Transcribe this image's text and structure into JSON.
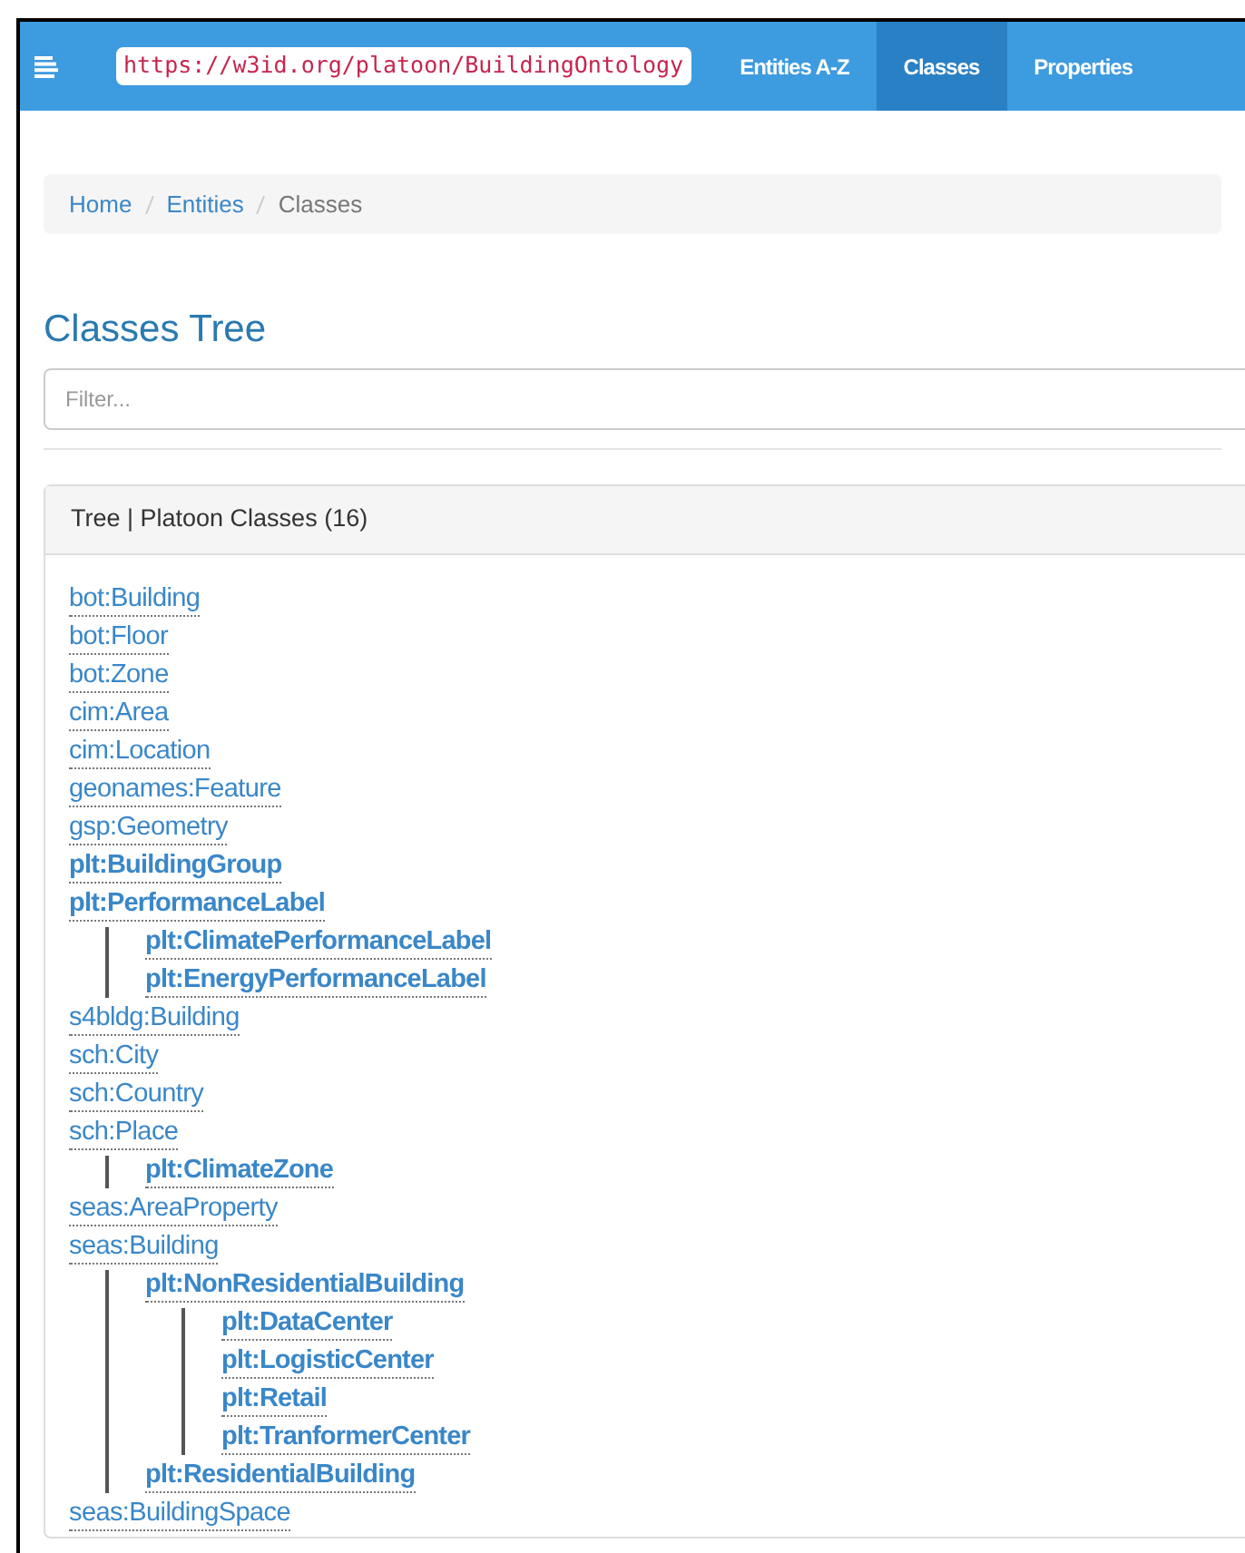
{
  "navbar": {
    "url": "https://w3id.org/platoon/BuildingOntology",
    "links": [
      {
        "label": "Entities A-Z",
        "selected": false
      },
      {
        "label": "Classes",
        "selected": true
      },
      {
        "label": "Properties",
        "selected": false
      }
    ]
  },
  "breadcrumb": [
    {
      "label": "Home",
      "link": true
    },
    {
      "label": "Entities",
      "link": true
    },
    {
      "label": "Classes",
      "link": false
    }
  ],
  "heading": "Classes Tree",
  "filter": {
    "placeholder": "Filter..."
  },
  "panel": {
    "title": "Tree | Platoon Classes (16)"
  },
  "tree": [
    {
      "label": "bot:Building",
      "bold": false
    },
    {
      "label": "bot:Floor",
      "bold": false
    },
    {
      "label": "bot:Zone",
      "bold": false
    },
    {
      "label": "cim:Area",
      "bold": false
    },
    {
      "label": "cim:Location",
      "bold": false
    },
    {
      "label": "geonames:Feature",
      "bold": false
    },
    {
      "label": "gsp:Geometry",
      "bold": false
    },
    {
      "label": "plt:BuildingGroup",
      "bold": true
    },
    {
      "label": "plt:PerformanceLabel",
      "bold": true,
      "children": [
        {
          "label": "plt:ClimatePerformanceLabel",
          "bold": true
        },
        {
          "label": "plt:EnergyPerformanceLabel",
          "bold": true
        }
      ]
    },
    {
      "label": "s4bldg:Building",
      "bold": false
    },
    {
      "label": "sch:City",
      "bold": false
    },
    {
      "label": "sch:Country",
      "bold": false
    },
    {
      "label": "sch:Place",
      "bold": false,
      "children": [
        {
          "label": "plt:ClimateZone",
          "bold": true
        }
      ]
    },
    {
      "label": "seas:AreaProperty",
      "bold": false
    },
    {
      "label": "seas:Building",
      "bold": false,
      "children": [
        {
          "label": "plt:NonResidentialBuilding",
          "bold": true,
          "children": [
            {
              "label": "plt:DataCenter",
              "bold": true
            },
            {
              "label": "plt:LogisticCenter",
              "bold": true
            },
            {
              "label": "plt:Retail",
              "bold": true
            },
            {
              "label": "plt:TranformerCenter",
              "bold": true
            }
          ]
        },
        {
          "label": "plt:ResidentialBuilding",
          "bold": true
        }
      ]
    },
    {
      "label": "seas:BuildingSpace",
      "bold": false
    }
  ]
}
